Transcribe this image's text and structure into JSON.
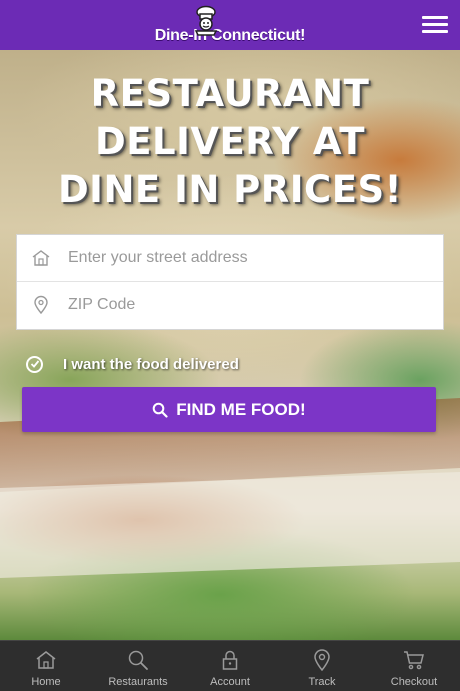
{
  "header": {
    "logo_text": "Dine-In Connecticut!",
    "menu_icon": "hamburger-menu-icon",
    "accent_color": "#6c2bb5"
  },
  "hero": {
    "headline": [
      "RESTAURANT",
      "DELIVERY AT",
      "DINE IN PRICES!"
    ]
  },
  "form": {
    "address_placeholder": "Enter your street address",
    "address_value": "",
    "address_icon": "home-icon",
    "zip_placeholder": "ZIP Code",
    "zip_value": "",
    "zip_icon": "map-pin-icon",
    "delivery_label": "I want the food delivered",
    "delivery_checked": true,
    "submit_label": "FIND ME FOOD!",
    "submit_icon": "search-icon",
    "button_color": "#7c35c7"
  },
  "bottom_nav": {
    "items": [
      {
        "label": "Home",
        "icon": "home-icon"
      },
      {
        "label": "Restaurants",
        "icon": "search-icon"
      },
      {
        "label": "Account",
        "icon": "lock-icon"
      },
      {
        "label": "Track",
        "icon": "map-pin-icon"
      },
      {
        "label": "Checkout",
        "icon": "cart-icon"
      }
    ]
  }
}
